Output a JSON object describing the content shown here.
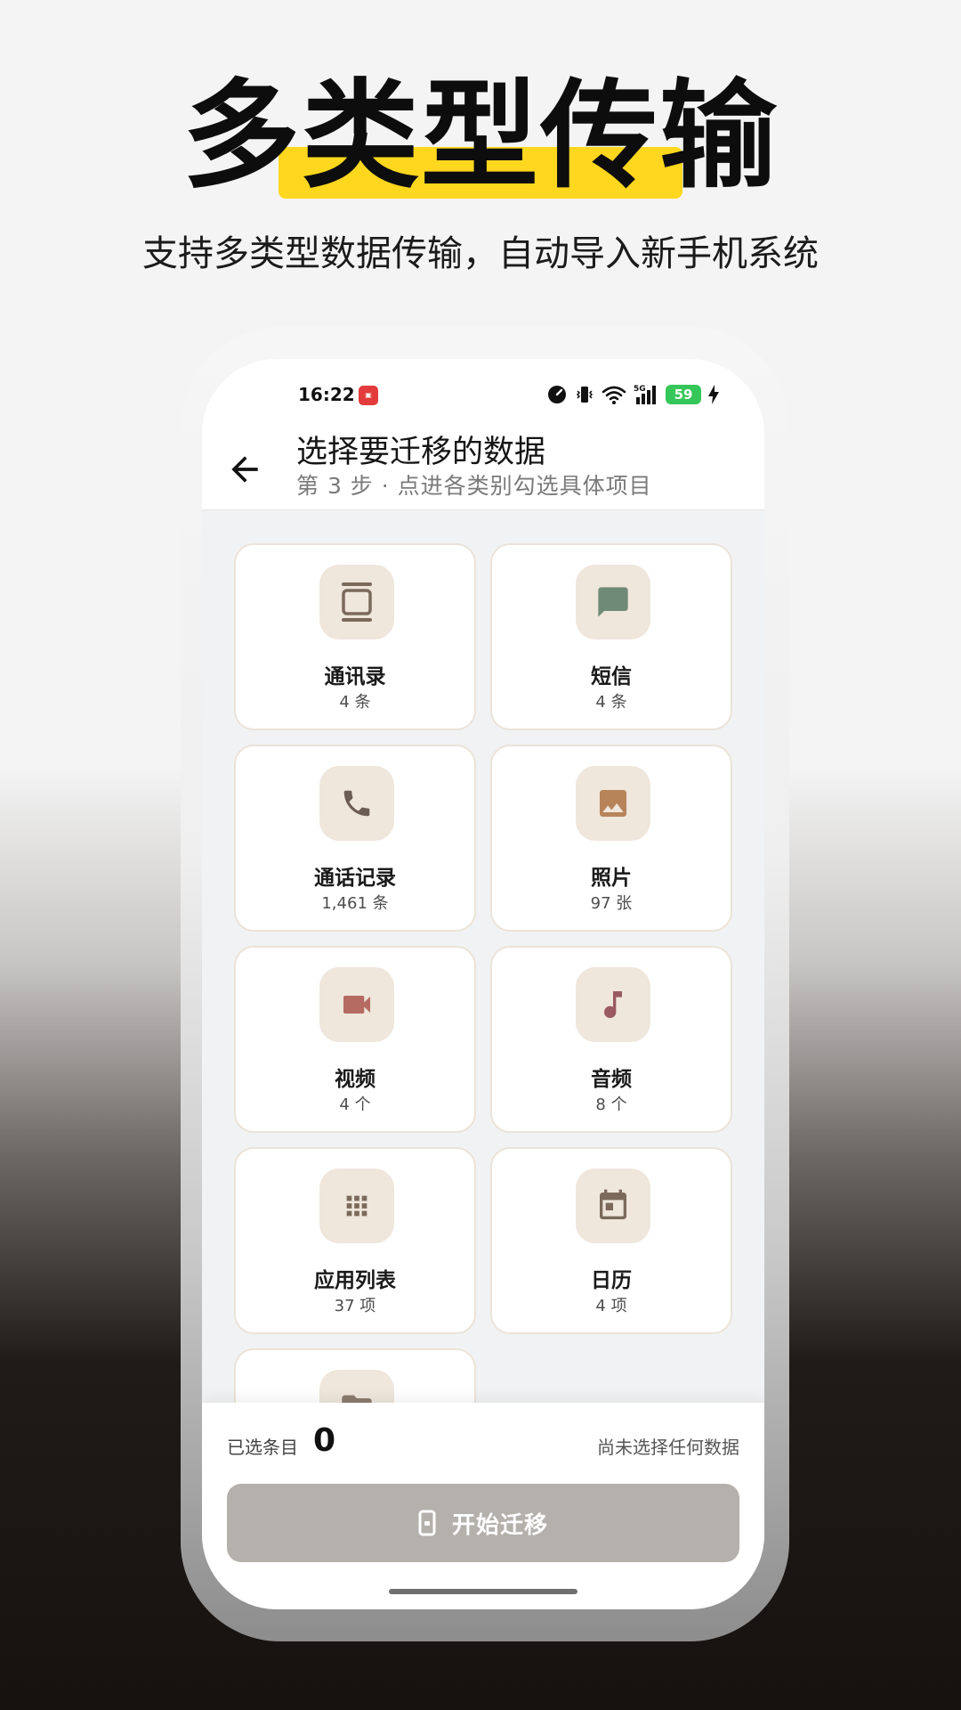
{
  "hero": {
    "title": "多类型传输",
    "subtitle": "支持多类型数据传输，自动导入新手机系统"
  },
  "status_bar": {
    "time": "16:22",
    "battery": "59",
    "network": "5G"
  },
  "app_bar": {
    "title": "选择要迁移的数据",
    "subtitle": "第 3 步 · 点进各类别勾选具体项目"
  },
  "categories": [
    {
      "label": "通讯录",
      "count": "4 条",
      "icon": "contacts-icon"
    },
    {
      "label": "短信",
      "count": "4 条",
      "icon": "message-icon"
    },
    {
      "label": "通话记录",
      "count": "1,461 条",
      "icon": "phone-icon"
    },
    {
      "label": "照片",
      "count": "97 张",
      "icon": "image-icon"
    },
    {
      "label": "视频",
      "count": "4 个",
      "icon": "video-icon"
    },
    {
      "label": "音频",
      "count": "8 个",
      "icon": "music-icon"
    },
    {
      "label": "应用列表",
      "count": "37 项",
      "icon": "apps-grid-icon"
    },
    {
      "label": "日历",
      "count": "4 项",
      "icon": "calendar-icon"
    }
  ],
  "footer": {
    "selected_label": "已选条目",
    "selected_count": "0",
    "status_text": "尚未选择任何数据",
    "start_button_label": "开始迁移"
  },
  "colors": {
    "accent_yellow": "#ffd71e",
    "icon_tile_bg": "#efe6dc",
    "contacts_icon": "#7b6a5c",
    "message_icon": "#6f8b78",
    "phone_icon": "#6b5d52",
    "image_icon": "#b7845a",
    "video_icon": "#b56b62",
    "music_icon": "#9a5a5f",
    "apps_icon": "#7b6a5c",
    "calendar_icon": "#7b6a5c",
    "disabled_button": "#b4b0ac"
  }
}
